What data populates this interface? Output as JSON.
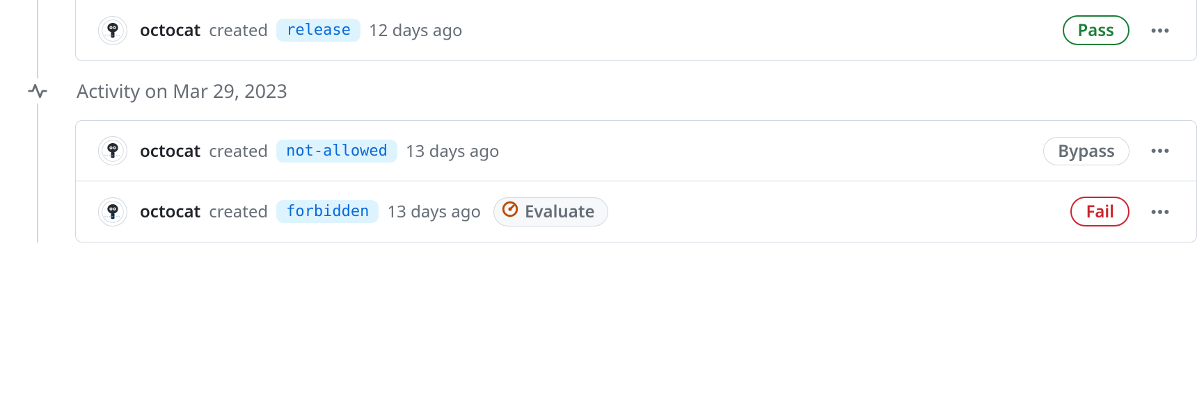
{
  "groups": [
    {
      "rows": [
        {
          "actor": "octocat",
          "verb": "created",
          "branch": "release",
          "time": "12 days ago",
          "status": {
            "label": "Pass",
            "variant": "pass"
          },
          "evaluate": null
        }
      ]
    }
  ],
  "date_header": "Activity on Mar 29, 2023",
  "group2": {
    "rows": [
      {
        "actor": "octocat",
        "verb": "created",
        "branch": "not-allowed",
        "time": "13 days ago",
        "status": {
          "label": "Bypass",
          "variant": "bypass"
        },
        "evaluate": null
      },
      {
        "actor": "octocat",
        "verb": "created",
        "branch": "forbidden",
        "time": "13 days ago",
        "status": {
          "label": "Fail",
          "variant": "fail"
        },
        "evaluate": "Evaluate"
      }
    ]
  }
}
